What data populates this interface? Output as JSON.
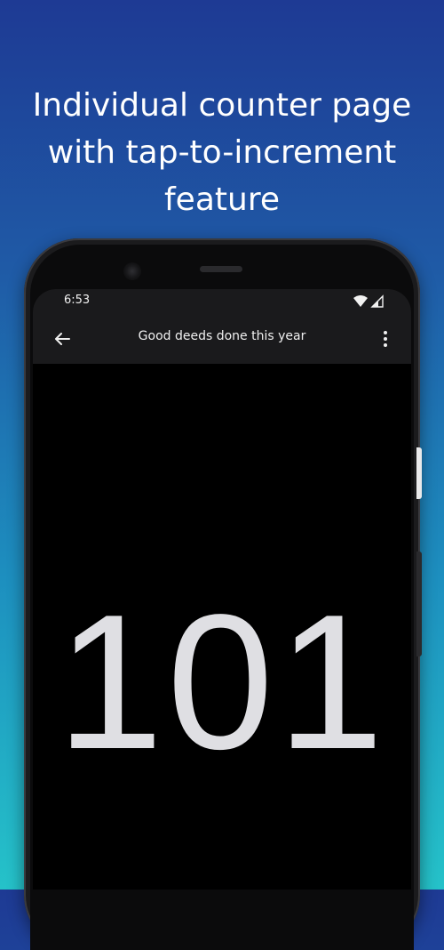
{
  "caption": {
    "line1": "Individual counter page",
    "line2": "with tap-to-increment",
    "line3": "feature"
  },
  "status_bar": {
    "time": "6:53",
    "icons": [
      "wifi-icon",
      "cellular-signal-icon"
    ]
  },
  "app_bar": {
    "title": "Good deeds done this year",
    "back_icon": "arrow-left-icon",
    "menu_icon": "more-vertical-icon"
  },
  "counter": {
    "value": "101"
  },
  "colors": {
    "screen_background": "#000000",
    "app_bar_background": "#1a1a1c",
    "counter_text": "#dfdfe3",
    "gradient_top": "#1e3a94",
    "gradient_bottom": "#25c2c9"
  }
}
